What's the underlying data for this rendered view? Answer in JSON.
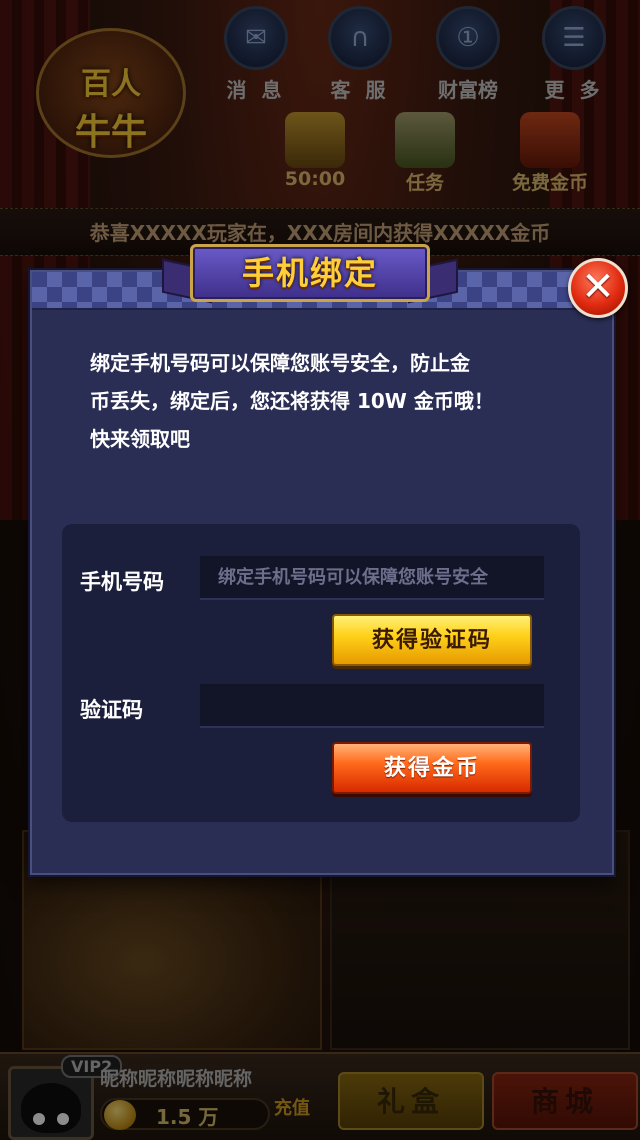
{
  "background": {
    "logo": {
      "line1": "百人",
      "line2": "牛牛"
    },
    "nav": [
      {
        "label": "消 息",
        "icon": "envelope-icon"
      },
      {
        "label": "客 服",
        "icon": "headset-icon"
      },
      {
        "label": "财富榜",
        "icon": "medal-icon"
      },
      {
        "label": "更 多",
        "icon": "menu-list-icon"
      }
    ],
    "sub": [
      {
        "label": "50:00",
        "icon": "coin-stack-icon"
      },
      {
        "label": "任务",
        "icon": "task-check-icon"
      },
      {
        "label": "免费金币",
        "icon": "gift-box-icon"
      }
    ],
    "ticker": "恭喜XXXXX玩家在，XXX房间内获得XXXXX金币",
    "user": {
      "vip": "VIP2",
      "nickname": "昵称昵称昵称昵称",
      "coins": "1.5 万",
      "recharge": "充值"
    },
    "bottom_buttons": {
      "gift": "礼盒",
      "shop": "商城"
    }
  },
  "dialog": {
    "title": "手机绑定",
    "intro_lines": [
      "绑定手机号码可以保障您账号安全，防止金",
      "币丢失，绑定后，您还将获得 10W 金币哦！",
      "快来领取吧"
    ],
    "phone_label": "手机号码",
    "phone_placeholder": "绑定手机号码可以保障您账号安全",
    "phone_value": "",
    "get_code_button": "获得验证码",
    "code_label": "验证码",
    "code_placeholder": "",
    "code_value": "",
    "get_coins_button": "获得金币",
    "close_icon": "close-icon"
  },
  "colors": {
    "dialog_bg": "#2a2e55",
    "panel_bg": "#1c1f3c",
    "title_gold": "#ffcf3a",
    "btn_yellow": "#ffd21a",
    "btn_orange": "#ff6a1a",
    "close_red": "#e02a10"
  }
}
